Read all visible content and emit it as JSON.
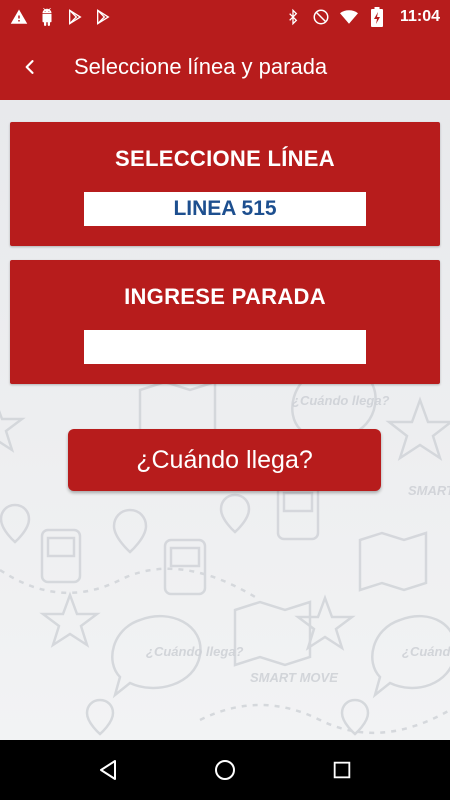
{
  "status_bar": {
    "time": "11:04",
    "left_icons": [
      "warning-icon",
      "android-icon",
      "play-store-icon",
      "play-store-icon"
    ],
    "right_icons": [
      "bluetooth-icon",
      "do-not-disturb-icon",
      "wifi-icon",
      "battery-charging-icon"
    ]
  },
  "app_bar": {
    "title": "Seleccione línea y parada",
    "color": "#b71c1c"
  },
  "line_card": {
    "title": "SELECCIONE LÍNEA",
    "value": "LINEA 515"
  },
  "stop_card": {
    "title": "INGRESE PARADA",
    "value": ""
  },
  "action_button": {
    "label": "¿Cuándo llega?"
  },
  "background": {
    "watermark_texts": [
      "¿Cuándo llega?",
      "SMART MOVE"
    ]
  },
  "nav_bar": {
    "buttons": [
      "back-triangle-icon",
      "home-circle-icon",
      "recents-square-icon"
    ]
  }
}
